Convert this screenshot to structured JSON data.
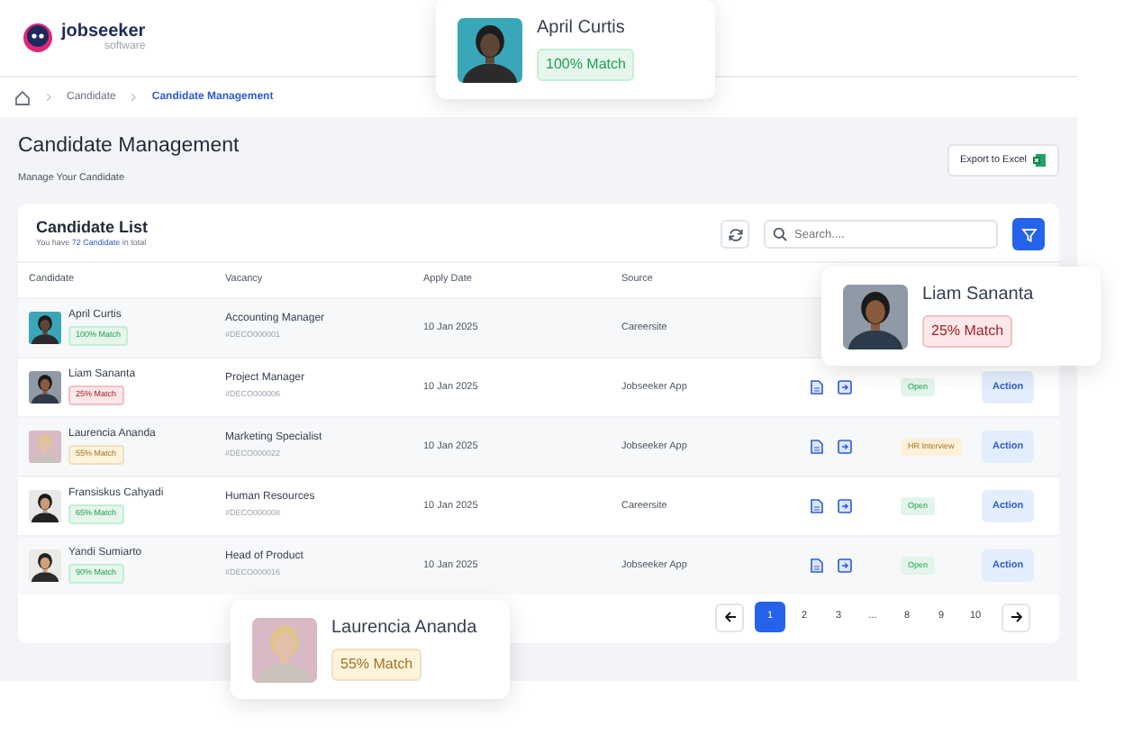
{
  "logo": {
    "name": "jobseeker",
    "tagline": "software"
  },
  "breadcrumb": [
    {
      "label": "Candidate",
      "selected": false
    },
    {
      "label": "Candidate Management",
      "selected": true
    }
  ],
  "page": {
    "title": "Candidate Management",
    "subtitle": "Manage Your Candidate",
    "export_button": "Export to Excel"
  },
  "list": {
    "title": "Candidate List",
    "summary_before": "You have",
    "summary_count": "72 Candidate",
    "summary_after": "in total",
    "search_placeholder": "Search....",
    "columns": [
      "Candidate",
      "Vacancy",
      "Apply Date",
      "Source"
    ],
    "rows": [
      {
        "name": "April Curtis",
        "match": "100% Match",
        "color": "#e6f6ec",
        "vacancy": "Accounting Manager",
        "code": "#DECO000001",
        "date": "10 Jan 2025",
        "source": "Careersite"
      },
      {
        "name": "Liam Sananta",
        "match": "25% Match",
        "color": "#fde8e9",
        "vacancy": "Project Manager",
        "code": "#DECO000006",
        "date": "10 Jan 2025",
        "source": "Jobseeker App",
        "status": {
          "label": "Open",
          "color": "#e3f5ea"
        },
        "action": "Action"
      },
      {
        "name": "Laurencia Ananda",
        "match": "55% Match",
        "color": "#fff3dc",
        "vacancy": "Marketing Specialist",
        "code": "#DECO000022",
        "date": "10 Jan 2025",
        "source": "Jobseeker App",
        "status": {
          "label": "HR Interview",
          "color": "#fff1d9"
        },
        "action": "Action"
      },
      {
        "name": "Fransiskus Cahyadi",
        "match": "65% Match",
        "color": "#e6f6ec",
        "vacancy": "Human Resources",
        "code": "#DECO000008",
        "date": "10 Jan 2025",
        "source": "Careersite",
        "status": {
          "label": "Open",
          "color": "#e3f5ea"
        },
        "action": "Action"
      },
      {
        "name": "Yandi Sumiarto",
        "match": "90% Match",
        "color": "#e6f6ec",
        "vacancy": "Head of Product",
        "code": "#DECO000016",
        "date": "10 Jan 2025",
        "source": "Jobseeker App",
        "status": {
          "label": "Open",
          "color": "#e3f5ea"
        },
        "action": "Action"
      }
    ],
    "pagination": [
      {
        "label": "1",
        "selected": true
      },
      {
        "label": "2",
        "selected": false
      },
      {
        "label": "3",
        "selected": false
      },
      {
        "label": "...",
        "selected": false
      },
      {
        "label": "8",
        "selected": false
      },
      {
        "label": "9",
        "selected": false
      },
      {
        "label": "10",
        "selected": false
      }
    ]
  },
  "highlight_cards": [
    {
      "name": "April Curtis",
      "match": "100% Match",
      "color": "#e6f6ec"
    },
    {
      "name": "Liam Sananta",
      "match": "25% Match",
      "color": "#fde8e9"
    },
    {
      "name": "Laurencia Ananda",
      "match": "55% Match",
      "color": "#fff3dc"
    }
  ]
}
